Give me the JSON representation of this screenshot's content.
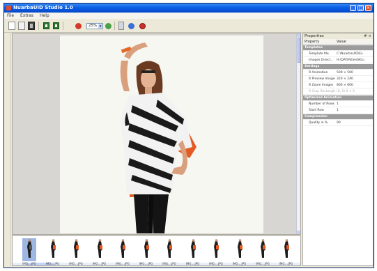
{
  "window": {
    "title": "NuarbaUID Studio 1.0"
  },
  "menu": [
    "File",
    "Extras",
    "Help"
  ],
  "toolbar": {
    "zoom_value": "25%",
    "icons": [
      "new-document-icon",
      "open-document-icon",
      "film-icon",
      "export-grid-icon",
      "import-grid-icon",
      "record-icon",
      "zoom-in-icon",
      "disk-icon",
      "info-icon",
      "stop-icon"
    ]
  },
  "viewer": {
    "image_description_icon": "model-photo",
    "scroll_position": 0.05
  },
  "thumbnails": {
    "labels": [
      "IMG....JPG",
      "IMG....JPG",
      "IMG....JPG",
      "IMG....JPG",
      "IMG....JPG",
      "IMG....JPG",
      "IMG....JPG",
      "IMG....JPG",
      "IMG....JPG",
      "IMG....JPG",
      "IMG....JPG",
      "IMG....JPG"
    ],
    "selected_index": 0
  },
  "properties": {
    "title": "Properties",
    "pin": "# ×",
    "col_property": "Property",
    "col_value": "Value",
    "rows": [
      {
        "type": "cat",
        "label": "Templates"
      },
      {
        "type": "prop",
        "label": "Template file",
        "value": "C:\\NuarbaUID\\Ex"
      },
      {
        "type": "prop",
        "label": "Images Direct...",
        "value": "H:\\DATA\\Kleid\\Kru"
      },
      {
        "type": "cat",
        "label": "Settings"
      },
      {
        "type": "prop",
        "label": "R Animation",
        "value": "500 × 500"
      },
      {
        "type": "prop",
        "label": "R Preview Images",
        "value": "320 × 240"
      },
      {
        "type": "prop",
        "label": "R Zoom Images",
        "value": "800 × 600"
      },
      {
        "type": "prop",
        "label": "R Crop Rectangle",
        "value": "(0, 0) 0 × 0",
        "dim": true
      },
      {
        "type": "cat",
        "label": "Optimized Animation"
      },
      {
        "type": "prop",
        "label": "Number of Rows",
        "value": "1"
      },
      {
        "type": "prop",
        "label": "Start Row",
        "value": "1"
      },
      {
        "type": "cat",
        "label": "Compression"
      },
      {
        "type": "prop",
        "label": "Quality in %",
        "value": "90"
      }
    ]
  }
}
